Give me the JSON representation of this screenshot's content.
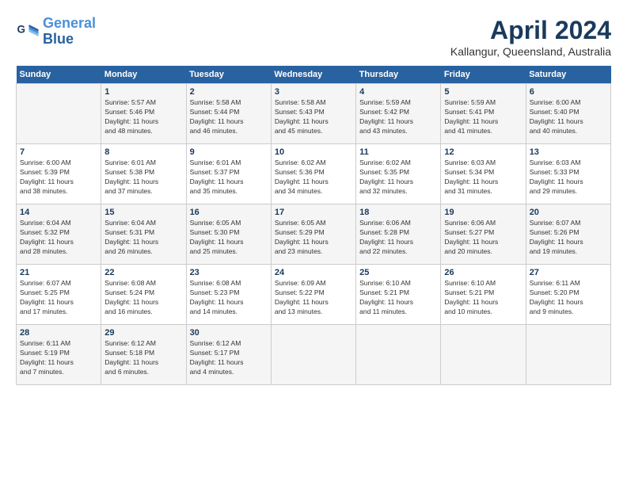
{
  "header": {
    "logo_line1": "General",
    "logo_line2": "Blue",
    "month": "April 2024",
    "location": "Kallangur, Queensland, Australia"
  },
  "weekdays": [
    "Sunday",
    "Monday",
    "Tuesday",
    "Wednesday",
    "Thursday",
    "Friday",
    "Saturday"
  ],
  "weeks": [
    [
      {
        "day": "",
        "info": ""
      },
      {
        "day": "1",
        "info": "Sunrise: 5:57 AM\nSunset: 5:46 PM\nDaylight: 11 hours\nand 48 minutes."
      },
      {
        "day": "2",
        "info": "Sunrise: 5:58 AM\nSunset: 5:44 PM\nDaylight: 11 hours\nand 46 minutes."
      },
      {
        "day": "3",
        "info": "Sunrise: 5:58 AM\nSunset: 5:43 PM\nDaylight: 11 hours\nand 45 minutes."
      },
      {
        "day": "4",
        "info": "Sunrise: 5:59 AM\nSunset: 5:42 PM\nDaylight: 11 hours\nand 43 minutes."
      },
      {
        "day": "5",
        "info": "Sunrise: 5:59 AM\nSunset: 5:41 PM\nDaylight: 11 hours\nand 41 minutes."
      },
      {
        "day": "6",
        "info": "Sunrise: 6:00 AM\nSunset: 5:40 PM\nDaylight: 11 hours\nand 40 minutes."
      }
    ],
    [
      {
        "day": "7",
        "info": "Sunrise: 6:00 AM\nSunset: 5:39 PM\nDaylight: 11 hours\nand 38 minutes."
      },
      {
        "day": "8",
        "info": "Sunrise: 6:01 AM\nSunset: 5:38 PM\nDaylight: 11 hours\nand 37 minutes."
      },
      {
        "day": "9",
        "info": "Sunrise: 6:01 AM\nSunset: 5:37 PM\nDaylight: 11 hours\nand 35 minutes."
      },
      {
        "day": "10",
        "info": "Sunrise: 6:02 AM\nSunset: 5:36 PM\nDaylight: 11 hours\nand 34 minutes."
      },
      {
        "day": "11",
        "info": "Sunrise: 6:02 AM\nSunset: 5:35 PM\nDaylight: 11 hours\nand 32 minutes."
      },
      {
        "day": "12",
        "info": "Sunrise: 6:03 AM\nSunset: 5:34 PM\nDaylight: 11 hours\nand 31 minutes."
      },
      {
        "day": "13",
        "info": "Sunrise: 6:03 AM\nSunset: 5:33 PM\nDaylight: 11 hours\nand 29 minutes."
      }
    ],
    [
      {
        "day": "14",
        "info": "Sunrise: 6:04 AM\nSunset: 5:32 PM\nDaylight: 11 hours\nand 28 minutes."
      },
      {
        "day": "15",
        "info": "Sunrise: 6:04 AM\nSunset: 5:31 PM\nDaylight: 11 hours\nand 26 minutes."
      },
      {
        "day": "16",
        "info": "Sunrise: 6:05 AM\nSunset: 5:30 PM\nDaylight: 11 hours\nand 25 minutes."
      },
      {
        "day": "17",
        "info": "Sunrise: 6:05 AM\nSunset: 5:29 PM\nDaylight: 11 hours\nand 23 minutes."
      },
      {
        "day": "18",
        "info": "Sunrise: 6:06 AM\nSunset: 5:28 PM\nDaylight: 11 hours\nand 22 minutes."
      },
      {
        "day": "19",
        "info": "Sunrise: 6:06 AM\nSunset: 5:27 PM\nDaylight: 11 hours\nand 20 minutes."
      },
      {
        "day": "20",
        "info": "Sunrise: 6:07 AM\nSunset: 5:26 PM\nDaylight: 11 hours\nand 19 minutes."
      }
    ],
    [
      {
        "day": "21",
        "info": "Sunrise: 6:07 AM\nSunset: 5:25 PM\nDaylight: 11 hours\nand 17 minutes."
      },
      {
        "day": "22",
        "info": "Sunrise: 6:08 AM\nSunset: 5:24 PM\nDaylight: 11 hours\nand 16 minutes."
      },
      {
        "day": "23",
        "info": "Sunrise: 6:08 AM\nSunset: 5:23 PM\nDaylight: 11 hours\nand 14 minutes."
      },
      {
        "day": "24",
        "info": "Sunrise: 6:09 AM\nSunset: 5:22 PM\nDaylight: 11 hours\nand 13 minutes."
      },
      {
        "day": "25",
        "info": "Sunrise: 6:10 AM\nSunset: 5:21 PM\nDaylight: 11 hours\nand 11 minutes."
      },
      {
        "day": "26",
        "info": "Sunrise: 6:10 AM\nSunset: 5:21 PM\nDaylight: 11 hours\nand 10 minutes."
      },
      {
        "day": "27",
        "info": "Sunrise: 6:11 AM\nSunset: 5:20 PM\nDaylight: 11 hours\nand 9 minutes."
      }
    ],
    [
      {
        "day": "28",
        "info": "Sunrise: 6:11 AM\nSunset: 5:19 PM\nDaylight: 11 hours\nand 7 minutes."
      },
      {
        "day": "29",
        "info": "Sunrise: 6:12 AM\nSunset: 5:18 PM\nDaylight: 11 hours\nand 6 minutes."
      },
      {
        "day": "30",
        "info": "Sunrise: 6:12 AM\nSunset: 5:17 PM\nDaylight: 11 hours\nand 4 minutes."
      },
      {
        "day": "",
        "info": ""
      },
      {
        "day": "",
        "info": ""
      },
      {
        "day": "",
        "info": ""
      },
      {
        "day": "",
        "info": ""
      }
    ]
  ]
}
